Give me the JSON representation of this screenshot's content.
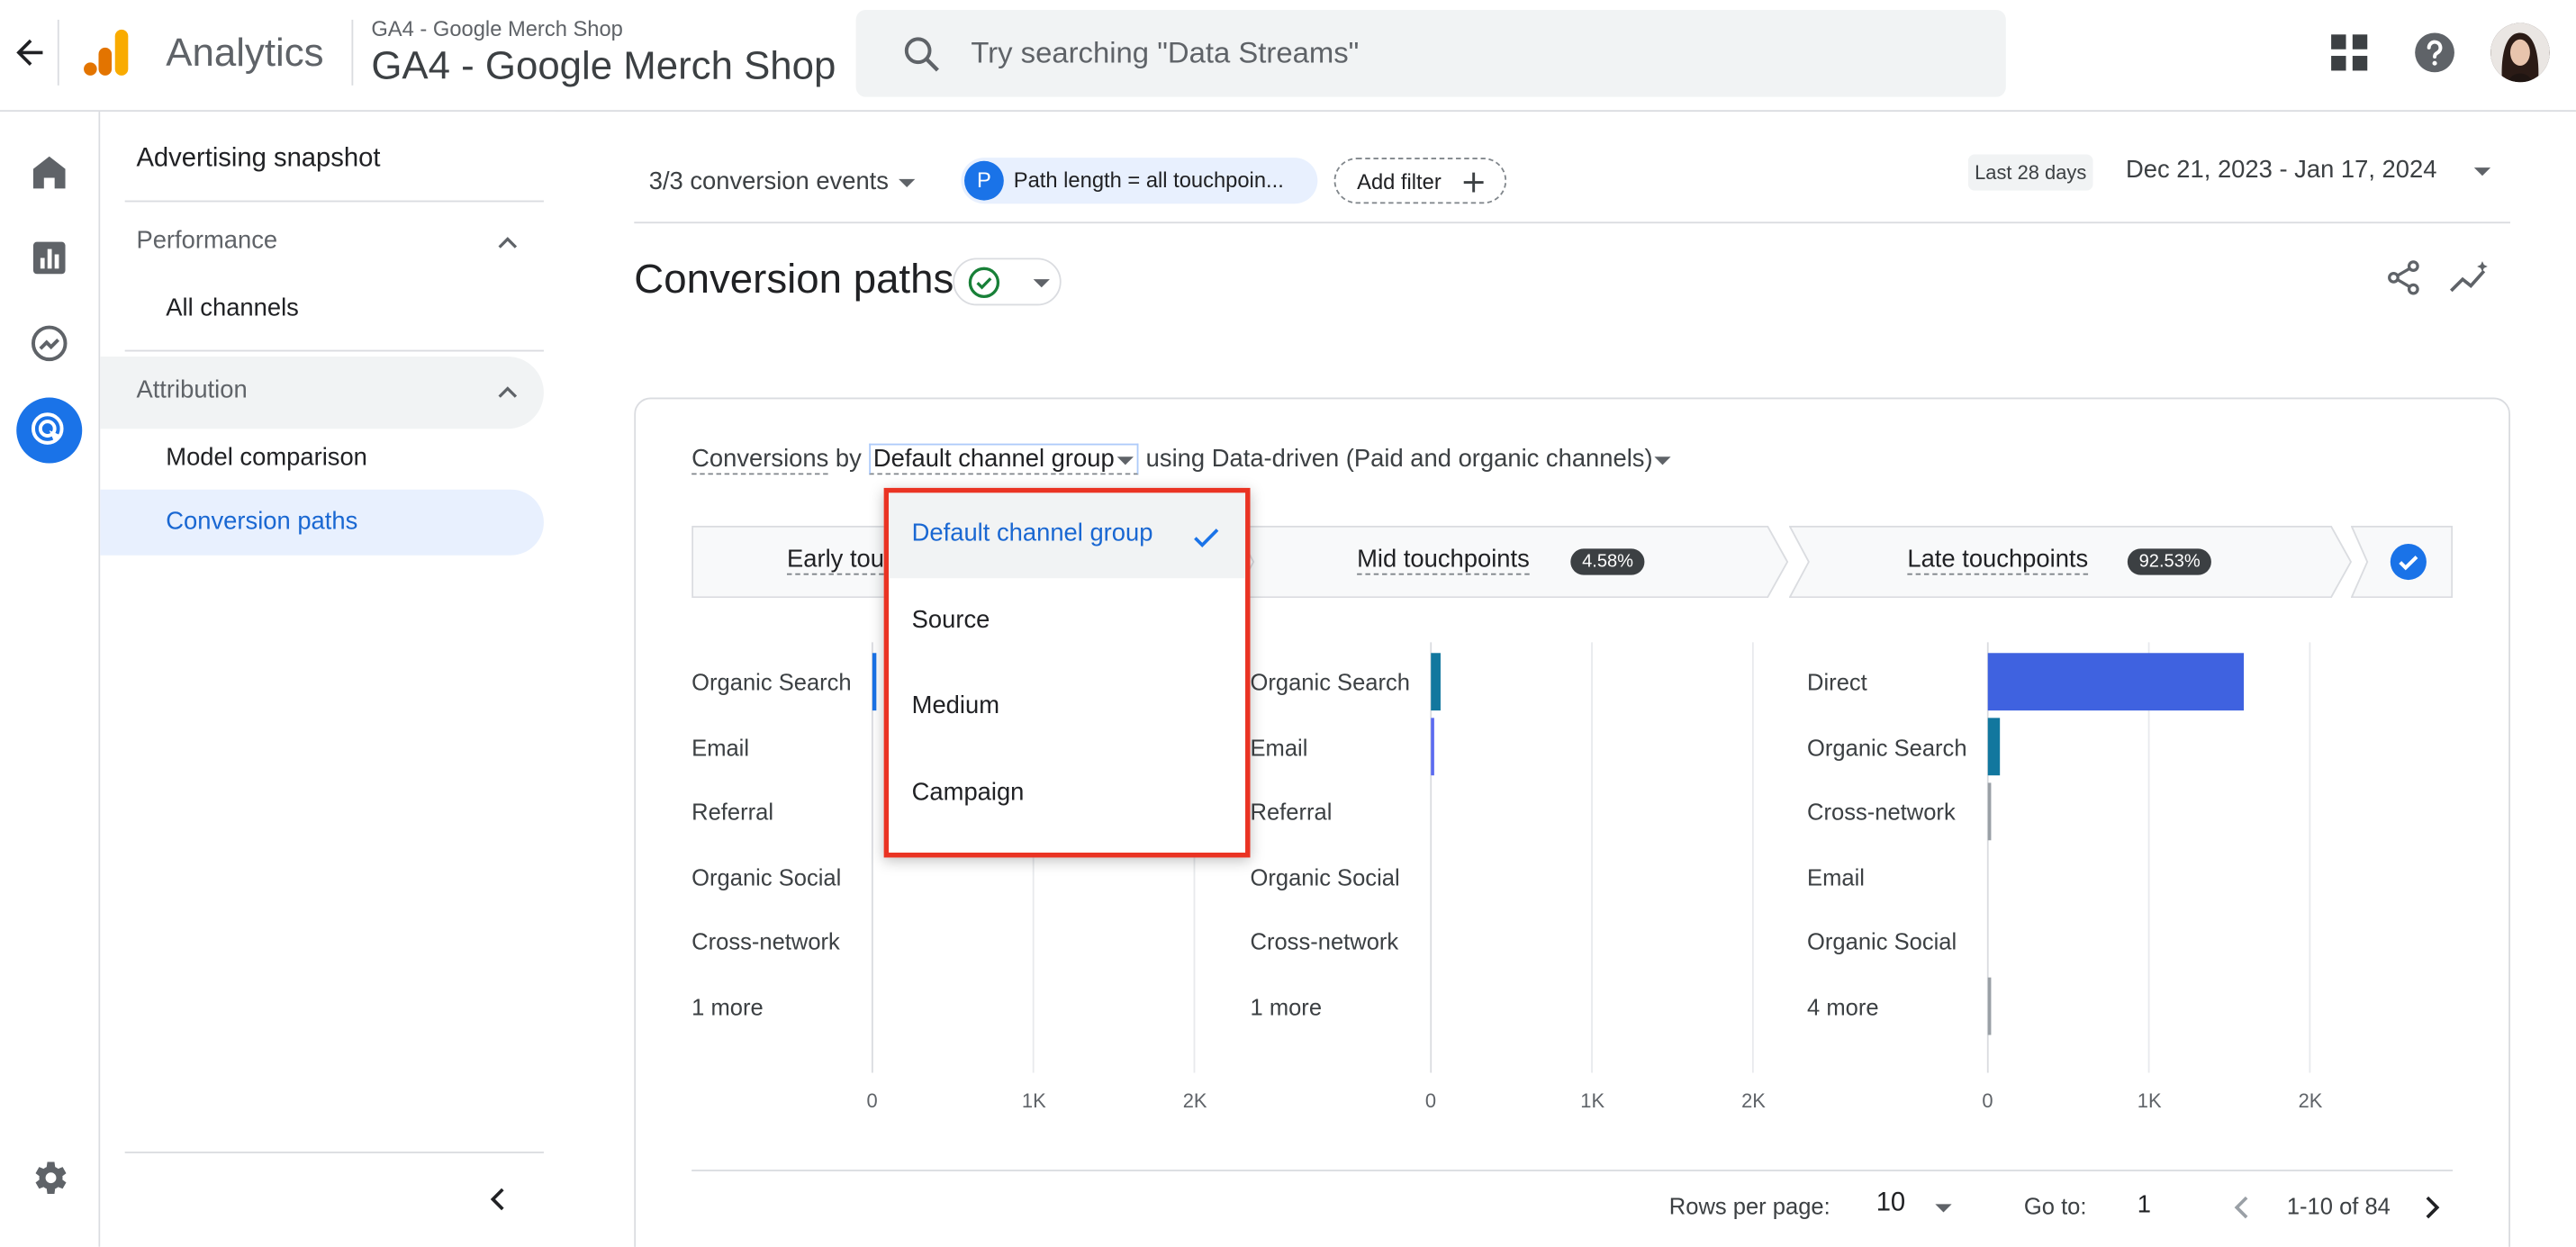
{
  "header": {
    "app_name": "Analytics",
    "property_small": "GA4 - Google Merch Shop",
    "property_big": "GA4 - Google Merch Shop",
    "search_placeholder": "Try searching \"Data Streams\"",
    "icons": [
      "back-arrow-icon",
      "analytics-logo-icon",
      "search-icon",
      "apps-grid-icon",
      "help-icon",
      "avatar"
    ]
  },
  "rail": {
    "icons": [
      "home-icon",
      "reports-icon",
      "explore-icon",
      "advertising-icon",
      "settings-icon"
    ],
    "active": "advertising-icon",
    "active_color": "#1a73e8"
  },
  "sidenav": {
    "title": "Advertising snapshot",
    "performance": {
      "label": "Performance",
      "items": [
        "All channels"
      ]
    },
    "attribution": {
      "label": "Attribution",
      "items": [
        "Model comparison",
        "Conversion paths"
      ],
      "active": "Conversion paths"
    }
  },
  "filterbar": {
    "conversion_events": "3/3 conversion events",
    "chip_letter": "P",
    "chip_text": "Path length = all touchpoin...",
    "add_filter": "Add filter",
    "date_badge": "Last 28 days",
    "date_range": "Dec 21, 2023 - Jan 17, 2024"
  },
  "page": {
    "title": "Conversion paths"
  },
  "card": {
    "header": {
      "metric": "Conversions",
      "by": "by",
      "dimension": "Default channel group",
      "using": "using",
      "model": "Data-driven (Paid and organic channels)"
    },
    "stages": [
      {
        "label": "Early tou",
        "pct": ""
      },
      {
        "label": "Mid touchpoints",
        "pct": "4.58%"
      },
      {
        "label": "Late touchpoints",
        "pct": "92.53%"
      }
    ],
    "pager": {
      "rows_label": "Rows per page:",
      "rows_value": "10",
      "goto_label": "Go to:",
      "goto_value": "1",
      "range": "1-10 of 84"
    }
  },
  "dropdown": {
    "options": [
      "Default channel group",
      "Source",
      "Medium",
      "Campaign"
    ],
    "selected": "Default channel group",
    "highlight_color": "#ea3323"
  },
  "chart_data": [
    {
      "type": "bar",
      "orientation": "horizontal",
      "categories": [
        "Organic Search",
        "Email",
        "Referral",
        "Organic Social",
        "Cross-network",
        "1 more"
      ],
      "values": [
        25,
        0,
        0,
        0,
        0,
        0
      ],
      "ticks": [
        "0",
        "1K",
        "2K"
      ],
      "xlim": [
        0,
        2000
      ],
      "colors": [
        "#1a73e8",
        "#1a73e8",
        "#1a73e8",
        "#1a73e8",
        "#1a73e8",
        "#1a73e8"
      ]
    },
    {
      "type": "bar",
      "orientation": "horizontal",
      "categories": [
        "Organic Search",
        "Email",
        "Referral",
        "Organic Social",
        "Cross-network",
        "1 more"
      ],
      "values": [
        60,
        10,
        0,
        0,
        0,
        0
      ],
      "ticks": [
        "0",
        "1K",
        "2K"
      ],
      "xlim": [
        0,
        2000
      ],
      "colors": [
        "#12779e",
        "#5c6bf0",
        "#4f67e0",
        "#4f67e0",
        "#4f67e0",
        "#4f67e0"
      ]
    },
    {
      "type": "bar",
      "orientation": "horizontal",
      "categories": [
        "Direct",
        "Organic Search",
        "Cross-network",
        "Email",
        "Organic Social",
        "4 more"
      ],
      "values": [
        1590,
        75,
        10,
        0,
        0,
        10
      ],
      "ticks": [
        "0",
        "1K",
        "2K"
      ],
      "xlim": [
        0,
        2000
      ],
      "colors": [
        "#3f62e0",
        "#12779e",
        "#9aa0a6",
        "#9aa0a6",
        "#9aa0a6",
        "#9aa0a6"
      ]
    }
  ]
}
